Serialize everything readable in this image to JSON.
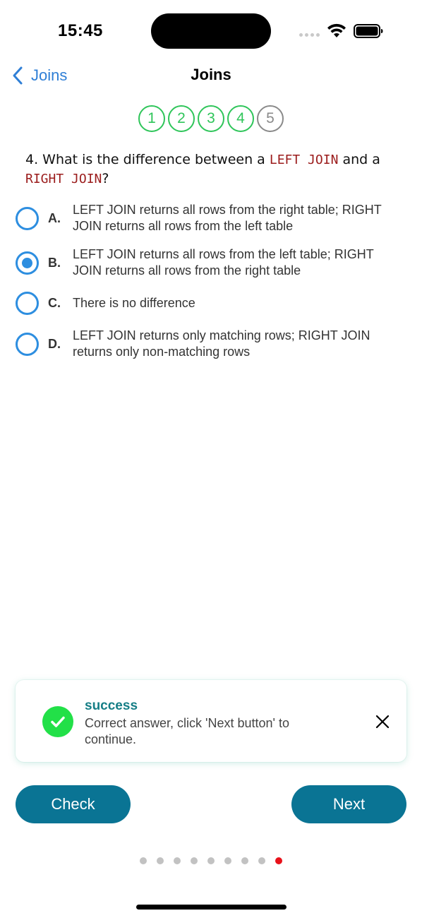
{
  "status_bar": {
    "time": "15:45"
  },
  "nav": {
    "back_label": "Joins",
    "title": "Joins"
  },
  "steps": [
    {
      "label": "1",
      "state": "done"
    },
    {
      "label": "2",
      "state": "done"
    },
    {
      "label": "3",
      "state": "done"
    },
    {
      "label": "4",
      "state": "done"
    },
    {
      "label": "5",
      "state": "pending"
    }
  ],
  "question": {
    "prefix": "4. What is the difference between a ",
    "code1": "LEFT JOIN",
    "middle": " and a ",
    "code2": "RIGHT JOIN",
    "suffix": "?"
  },
  "options": [
    {
      "letter": "A.",
      "text": "LEFT JOIN returns all rows from the right table; RIGHT JOIN returns all rows from the left table",
      "selected": false
    },
    {
      "letter": "B.",
      "text": "LEFT JOIN returns all rows from the left table; RIGHT JOIN returns all rows from the right table",
      "selected": true
    },
    {
      "letter": "C.",
      "text": "There is no difference",
      "selected": false
    },
    {
      "letter": "D.",
      "text": "LEFT JOIN returns only matching rows; RIGHT JOIN returns only non-matching rows",
      "selected": false
    }
  ],
  "toast": {
    "title": "success",
    "message": "Correct answer, click 'Next button' to continue."
  },
  "buttons": {
    "check_label": "Check",
    "next_label": "Next"
  },
  "pagination": {
    "total": 9,
    "active_index": 8
  },
  "colors": {
    "accent_blue": "#2d8ee0",
    "done_green": "#2fc55a",
    "button_teal": "#0a7494",
    "toast_title": "#167e86",
    "success_green": "#22e048",
    "active_dot": "#e8111a",
    "code_red": "#9b1c1c"
  }
}
